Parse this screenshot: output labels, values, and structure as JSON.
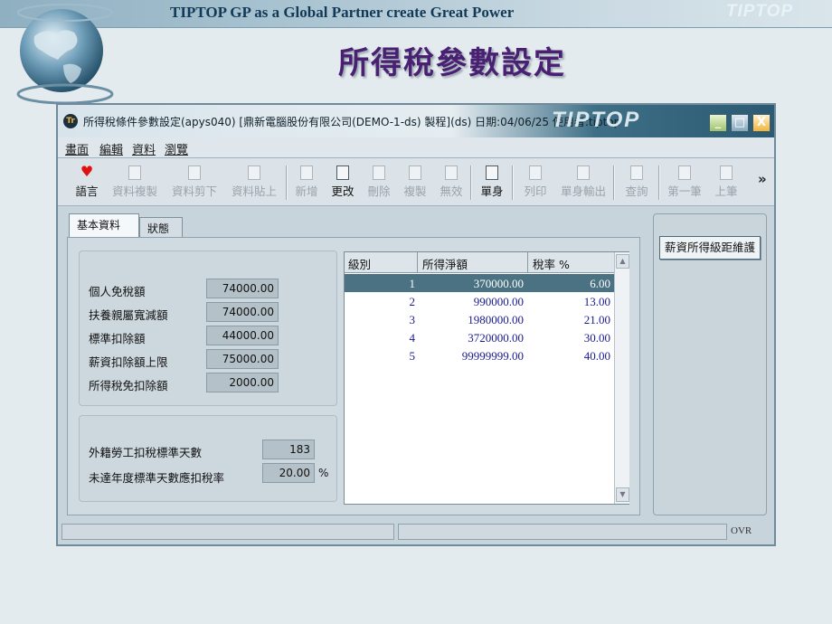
{
  "slide": {
    "banner": "TIPTOP GP as a Global Partner create Great Power",
    "brand": "TIPTOP",
    "title": "所得稅參數設定"
  },
  "window": {
    "title": "所得稅條件參數設定(apys040)  [鼎新電腦股份有限公司(DEMO-1-ds) 製程](ds)  日期:04/06/25  使用者:tiptop",
    "brand": "TIPTOP",
    "controls": {
      "minimize": "_",
      "maximize": "□",
      "close": "X"
    }
  },
  "menu": [
    "畫面",
    "編輯",
    "資料",
    "瀏覽"
  ],
  "toolbar": [
    {
      "label": "語言",
      "icon": "heart-icon",
      "enabled": true
    },
    {
      "label": "資料複製",
      "icon": "copy-icon",
      "enabled": false
    },
    {
      "label": "資料剪下",
      "icon": "cut-icon",
      "enabled": false
    },
    {
      "label": "資料貼上",
      "icon": "paste-icon",
      "enabled": false
    },
    {
      "label": "新增",
      "icon": "new-doc-icon",
      "enabled": false
    },
    {
      "label": "更改",
      "icon": "edit-icon",
      "enabled": true
    },
    {
      "label": "刪除",
      "icon": "trash-icon",
      "enabled": false
    },
    {
      "label": "複製",
      "icon": "duplicate-icon",
      "enabled": false
    },
    {
      "label": "無效",
      "icon": "invalid-icon",
      "enabled": false
    },
    {
      "label": "單身",
      "icon": "detail-icon",
      "enabled": true
    },
    {
      "label": "列印",
      "icon": "print-icon",
      "enabled": false
    },
    {
      "label": "單身輸出",
      "icon": "export-icon",
      "enabled": false
    },
    {
      "label": "查詢",
      "icon": "query-icon",
      "enabled": false
    },
    {
      "label": "第一筆",
      "icon": "first-record-icon",
      "enabled": false
    },
    {
      "label": "上筆",
      "icon": "prev-record-icon",
      "enabled": false
    },
    {
      "label": "»",
      "icon": "more-icon",
      "enabled": true
    }
  ],
  "tabs": [
    "基本資料",
    "狀態"
  ],
  "fields_a": [
    {
      "label": "個人免稅額",
      "value": "74000.00"
    },
    {
      "label": "扶養親屬寬減額",
      "value": "74000.00"
    },
    {
      "label": "標準扣除額",
      "value": "44000.00"
    },
    {
      "label": "薪資扣除額上限",
      "value": "75000.00"
    },
    {
      "label": "所得稅免扣除額",
      "value": "2000.00"
    }
  ],
  "fields_b": [
    {
      "label": "外籍勞工扣稅標準天數",
      "value": "183",
      "unit": ""
    },
    {
      "label": "未達年度標準天數應扣稅率",
      "value": "20.00",
      "unit": "%"
    }
  ],
  "grid": {
    "headers": [
      "級別",
      "所得淨額",
      "稅率 %"
    ],
    "rows": [
      {
        "level": "1",
        "income": "370000.00",
        "rate": "6.00"
      },
      {
        "level": "2",
        "income": "990000.00",
        "rate": "13.00"
      },
      {
        "level": "3",
        "income": "1980000.00",
        "rate": "21.00"
      },
      {
        "level": "4",
        "income": "3720000.00",
        "rate": "30.00"
      },
      {
        "level": "5",
        "income": "99999999.00",
        "rate": "40.00"
      }
    ],
    "selected_row": 0
  },
  "side_button": "薪資所得級距維護",
  "status": {
    "mode": "OVR"
  },
  "colors": {
    "title": "#4a2073",
    "selected_row": "#4a7283",
    "grid_text": "#1a1a8c"
  }
}
